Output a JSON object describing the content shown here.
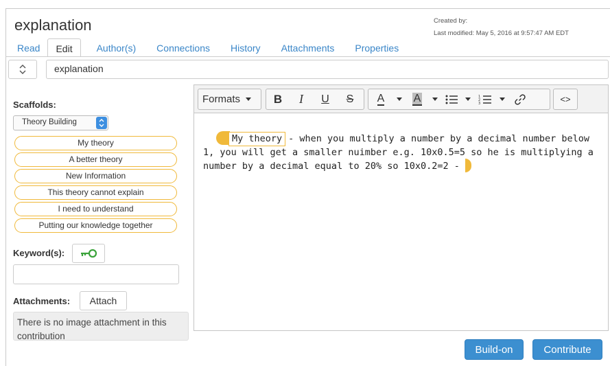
{
  "note": {
    "title": "explanation",
    "created_by": "Created by:",
    "last_modified": "Last modified: May 5, 2016 at 9:57:47 AM EDT",
    "title_value": "explanation"
  },
  "tabs": [
    {
      "label": "Read"
    },
    {
      "label": "Edit"
    },
    {
      "label": "Author(s)"
    },
    {
      "label": "Connections"
    },
    {
      "label": "History"
    },
    {
      "label": "Attachments"
    },
    {
      "label": "Properties"
    }
  ],
  "scaffolds": {
    "label": "Scaffolds:",
    "selected": "Theory Building",
    "items": [
      "My theory",
      "A better theory",
      "New Information",
      "This theory cannot explain",
      "I need to understand",
      "Putting our knowledge together"
    ]
  },
  "keywords": {
    "label": "Keyword(s):",
    "value": ""
  },
  "attachments": {
    "label": "Attachments:",
    "button": "Attach",
    "empty_text": "There is no image attachment in this contribution"
  },
  "toolbar": {
    "formats": "Formats",
    "bold": "B",
    "italic": "I",
    "underline": "U",
    "strike": "S",
    "text_color": "A",
    "bg_color": "A",
    "code": "<>"
  },
  "editor": {
    "scaffold_tag": "My theory",
    "body": "- when you multiply a number by a decimal number below 1, you will get a smaller nuimber e.g. 10x0.5=5 so he is multiplying a number by a decimal equal to 20% so 10x0.2=2 -"
  },
  "buttons": {
    "build_on": "Build-on",
    "contribute": "Contribute"
  },
  "colors": {
    "accent": "#3c8fd0",
    "link": "#3a86c8",
    "scaffold": "#f0b93a",
    "keyword_icon": "#3aa33a"
  },
  "icons": {
    "title_select": "up-down-chevron-icon",
    "keyword": "key-icon",
    "bullet_list": "bullet-list-icon",
    "numbered_list": "numbered-list-icon",
    "link": "link-icon",
    "source_code": "code-icon"
  }
}
